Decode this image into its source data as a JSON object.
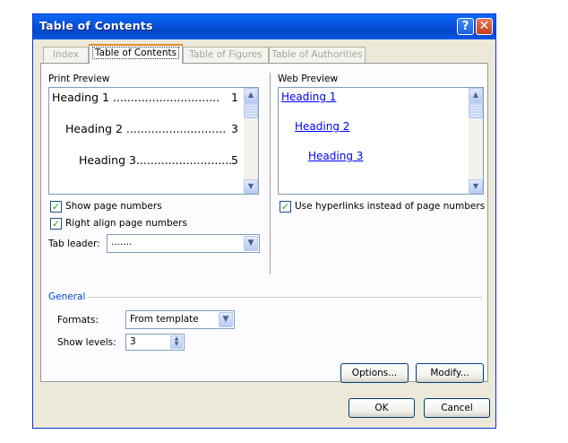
{
  "window": {
    "title": "Table of Contents"
  },
  "tabs": [
    "Index",
    "Table of Contents",
    "Table of Figures",
    "Table of Authorities"
  ],
  "print_preview": {
    "label": "Print Preview",
    "rows": [
      {
        "text": "Heading 1 ..............................",
        "page": "1"
      },
      {
        "text": "Heading 2 ............................",
        "page": "3"
      },
      {
        "text": "Heading 3...........................",
        "page": "5"
      }
    ]
  },
  "web_preview": {
    "label": "Web Preview",
    "links": [
      "Heading 1",
      "Heading 2",
      "Heading 3"
    ]
  },
  "options": {
    "show_page_numbers": "Show page numbers",
    "right_align": "Right align page numbers",
    "use_hyperlinks": "Use hyperlinks instead of page numbers",
    "tab_leader_label": "Tab leader:",
    "tab_leader_value": "......."
  },
  "general": {
    "label": "General",
    "formats_label": "Formats:",
    "formats_value": "From template",
    "show_levels_label": "Show levels:",
    "show_levels_value": "3"
  },
  "buttons": {
    "options": "Options...",
    "modify": "Modify...",
    "ok": "OK",
    "cancel": "Cancel"
  },
  "icons": {
    "help": "?",
    "close": "✕",
    "check": "✓",
    "up": "▲",
    "down": "▼"
  },
  "colors": {
    "title_bar": "#0A5AE6",
    "link": "#0000FF",
    "accent_tab": "#E68B2C"
  }
}
